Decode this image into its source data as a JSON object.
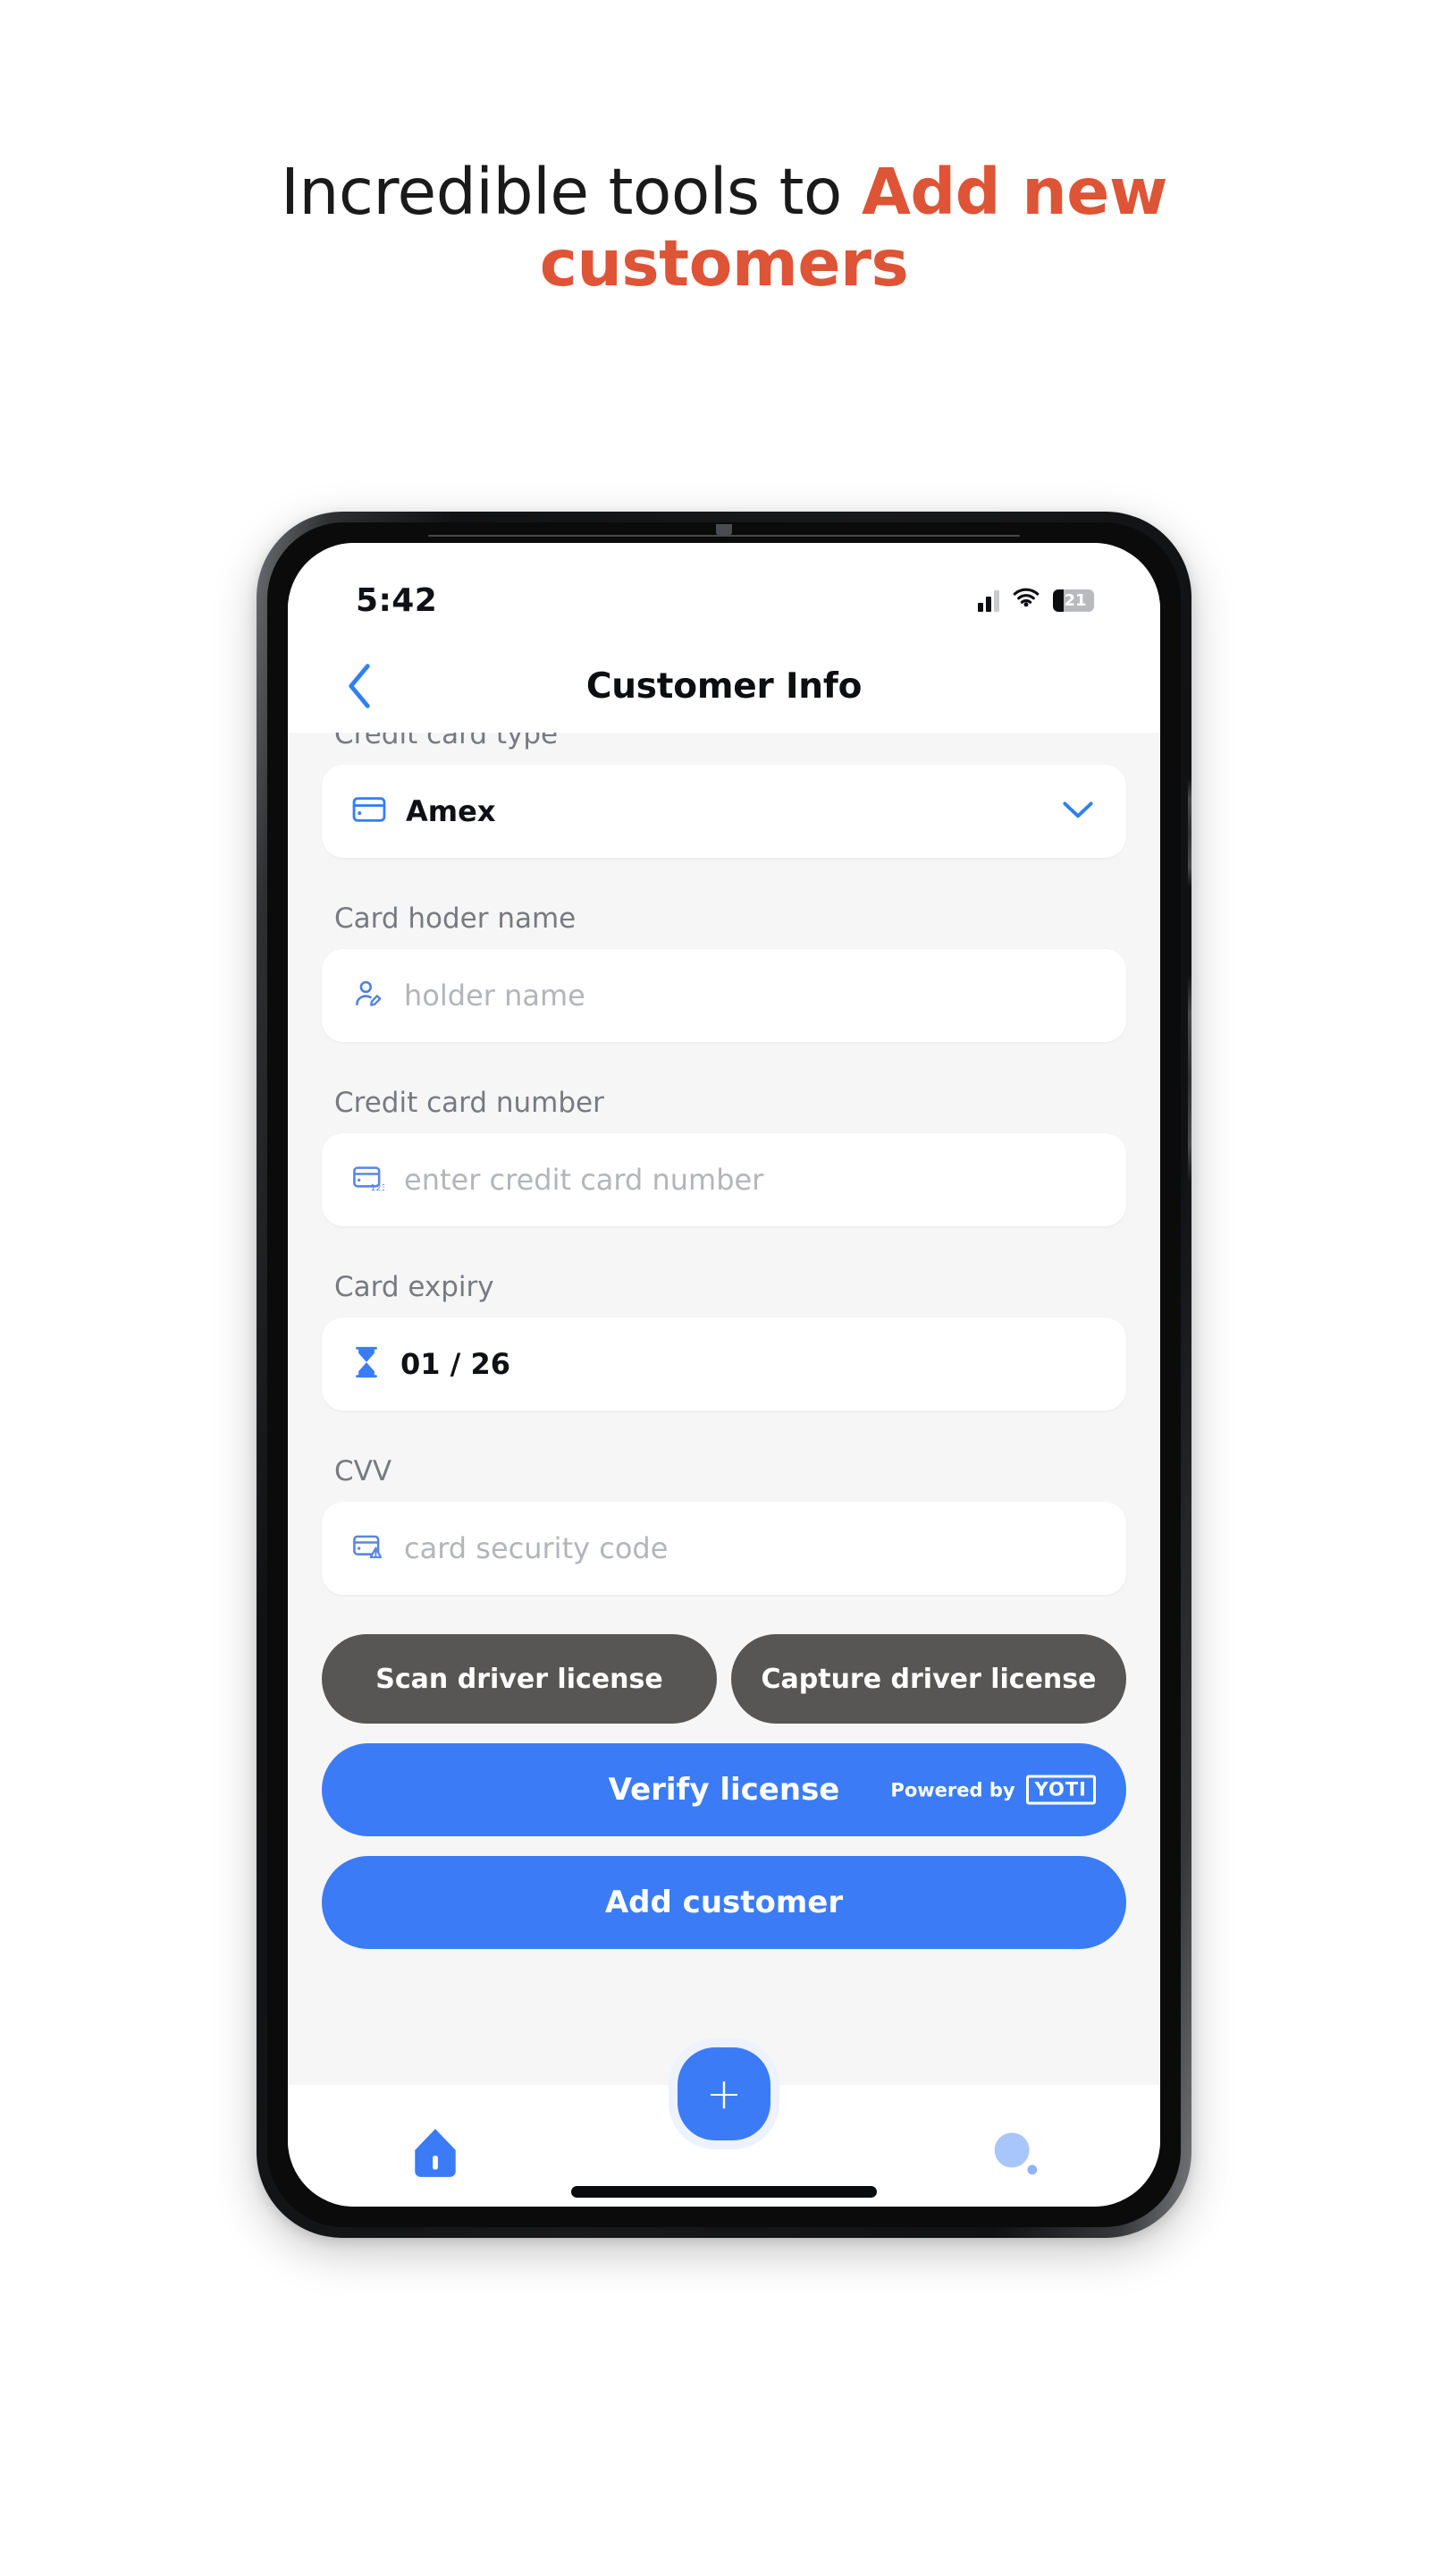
{
  "headline": {
    "line1_plain": "Incredible tools to ",
    "line1_accent": "Add new",
    "line2_accent": "customers",
    "accent_color": "#DE5436"
  },
  "phone": {
    "status_bar": {
      "time": "5:42",
      "battery_percent": "21",
      "signal_icon": "cellular-signal-icon",
      "wifi_icon": "wifi-icon",
      "battery_icon": "battery-icon"
    },
    "nav_header": {
      "back_icon": "chevron-left-icon",
      "title": "Customer Info"
    },
    "form": {
      "fields": [
        {
          "label": "Credit card type",
          "type": "dropdown",
          "icon": "credit-card-icon",
          "value": "Amex",
          "chevron_icon": "chevron-down-icon"
        },
        {
          "label": "Card hoder name",
          "type": "text",
          "icon": "person-edit-icon",
          "placeholder": "holder name",
          "value": ""
        },
        {
          "label": "Credit card number",
          "type": "text",
          "icon": "card-number-icon",
          "placeholder": "enter credit card number",
          "value": ""
        },
        {
          "label": "Card expiry",
          "type": "date",
          "icon": "hourglass-icon",
          "value": "01 / 26",
          "placeholder": ""
        },
        {
          "label": "CVV",
          "type": "text",
          "icon": "card-security-icon",
          "placeholder": "card security code",
          "value": ""
        }
      ],
      "secondary_buttons": [
        {
          "label": "Scan driver license"
        },
        {
          "label": "Capture driver license"
        }
      ],
      "verify_button": {
        "label": "Verify license",
        "powered_by": "Powered by",
        "brand": "YOTI",
        "brand_icon": "yoti-logo-icon"
      },
      "primary_button": {
        "label": "Add customer"
      }
    },
    "bottom_nav": {
      "home_icon": "home-icon",
      "fab_icon": "plus-icon",
      "fab_label": "+",
      "profile_icon": "profile-avatar-icon",
      "home_indicator": "home-indicator"
    }
  },
  "colors": {
    "accent_orange": "#DE5436",
    "primary_blue": "#3b7cf6",
    "dark_button": "#575654",
    "screen_bg": "#f6f6f7"
  }
}
